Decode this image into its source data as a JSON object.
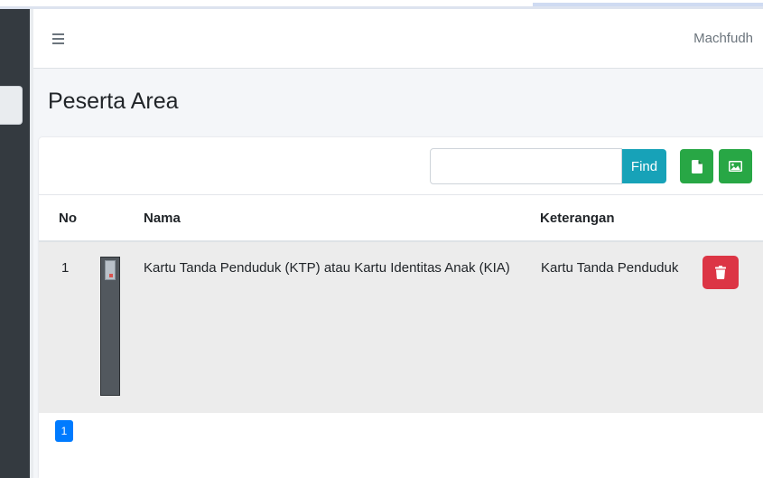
{
  "navbar": {
    "username": "Machfudh"
  },
  "page": {
    "title": "Peserta Area"
  },
  "toolbar": {
    "search_value": "",
    "find_label": "Find"
  },
  "table": {
    "headers": {
      "no": "No",
      "nama": "Nama",
      "keterangan": "Keterangan"
    },
    "rows": [
      {
        "no": "1",
        "nama": "Kartu Tanda Penduduk (KTP) atau Kartu Identitas Anak (KIA)",
        "keterangan": "Kartu Tanda Penduduk"
      }
    ]
  },
  "pagination": {
    "current": "1"
  },
  "colors": {
    "find": "#17a2b8",
    "green": "#28a745",
    "delete": "#dc3545",
    "page_active": "#007bff"
  },
  "icons": {
    "menu": "bars-icon",
    "file": "file-icon",
    "image": "image-icon",
    "delete": "trash-icon"
  }
}
